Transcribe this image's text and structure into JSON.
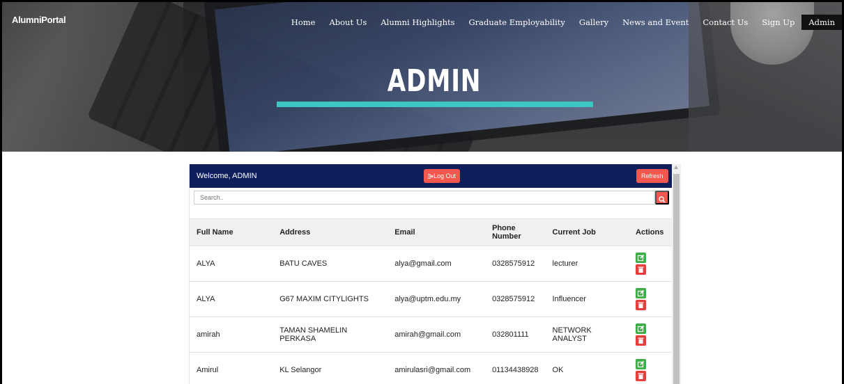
{
  "brand": "AlumniPortal",
  "nav": [
    "Home",
    "About Us",
    "Alumni Highlights",
    "Graduate Employability",
    "Gallery",
    "News and Event",
    "Contact Us",
    "Sign Up",
    "Admin"
  ],
  "hero": {
    "title": "ADMIN"
  },
  "panel": {
    "welcome": "Welcome, ADMIN",
    "logout_label": "Log Out",
    "refresh_label": "Refresh",
    "search_placeholder": "Search.."
  },
  "table": {
    "headers": [
      "Full Name",
      "Address",
      "Email",
      "Phone Number",
      "Current Job",
      "Actions"
    ],
    "rows": [
      [
        "ALYA",
        "BATU CAVES",
        "alya@gmail.com",
        "0328575912",
        "lecturer"
      ],
      [
        "ALYA",
        "G67 MAXIM CITYLIGHTS",
        "alya@uptm.edu.my",
        "0328575912",
        "Influencer"
      ],
      [
        "amirah",
        "TAMAN SHAMELIN PERKASA",
        "amirah@gmail.com",
        "032801111",
        "NETWORK ANALYST"
      ],
      [
        "Amirul",
        "KL Selangor",
        "amirulasri@gmail.com",
        "01134438928",
        "OK"
      ]
    ]
  },
  "colors": {
    "navbar": "#0e1f5b",
    "danger": "#f3574d",
    "edit": "#3fae49",
    "delete": "#e63d3d",
    "accent_bar": "#3cc6c4"
  },
  "icons": [
    "logout-icon",
    "search-icon",
    "edit-icon",
    "trash-icon"
  ]
}
